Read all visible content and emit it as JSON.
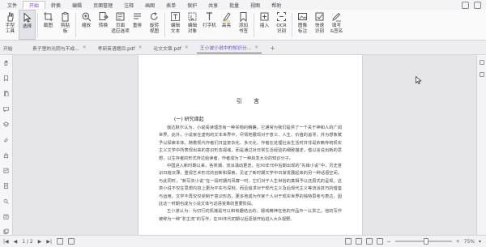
{
  "menu": {
    "tabs": [
      "文件",
      "开始",
      "转换",
      "编辑",
      "页面管理",
      "注释",
      "画图",
      "表单",
      "保护",
      "共享",
      "批量",
      "视图",
      "帮助"
    ],
    "active_tab": "开始"
  },
  "ribbon": {
    "tools": [
      {
        "label": "手型\n工具",
        "icon": "hand-icon"
      },
      {
        "label": "选择",
        "icon": "cursor-icon"
      },
      {
        "label": "截图",
        "icon": "snapshot-icon"
      },
      {
        "label": "剪贴\n板",
        "icon": "clipboard-icon"
      },
      {
        "label": "缩放",
        "icon": "zoom-icon"
      },
      {
        "label": "转换",
        "icon": "convert-icon"
      },
      {
        "label": "页面\n适应选项",
        "icon": "fit-page-icon"
      },
      {
        "label": "重排",
        "icon": "reflow-icon"
      },
      {
        "label": "旋转\n视图",
        "icon": "rotate-icon"
      },
      {
        "label": "编辑\n文本",
        "icon": "edit-text-icon"
      },
      {
        "label": "编辑\n对象",
        "icon": "edit-object-icon"
      },
      {
        "label": "打字机",
        "icon": "typewriter-icon"
      },
      {
        "label": "高亮",
        "icon": "highlight-icon"
      },
      {
        "label": "添加\n书签",
        "icon": "bookmark-icon"
      },
      {
        "label": "插入",
        "icon": "insert-icon"
      },
      {
        "label": "OCR\n识别",
        "icon": "ocr-icon"
      },
      {
        "label": "图像\n标注",
        "icon": "image-annot-icon"
      },
      {
        "label": "快速\n识别",
        "icon": "quick-ocr-icon"
      },
      {
        "label": "填写\n&签名",
        "icon": "sign-icon"
      }
    ]
  },
  "tabs": {
    "start_label": "开始",
    "docs": [
      {
        "title": "贵子里的光阴与不成...",
        "active": false
      },
      {
        "title": "考研英语题目.pdf",
        "active": false
      },
      {
        "title": "论文文章.pdf",
        "active": false
      },
      {
        "title": "王小波小说中的知识分...",
        "active": true
      }
    ],
    "add_label": "+"
  },
  "document": {
    "title": "引 言",
    "section": "(一) 研究缘起",
    "paragraphs": [
      "伽达默尔认为，小说阅读理念有一种实物的精确，它通常为我们提供了一个关于神和人的广阔世界。此外，小说家在虚构的文本世界中，尽情地展现对于意义、人生、价值的追寻，并为想象赋予以探索本体。随着现代作者们日益复杂化、多元化，作者在处理社会生活时并非是依赖传统现实主义文学中所表现出来的意识形态视域，而是通过对日常生活经验的细致描述，借以言说出新的思想，以生存者的形式传达给读者，作者成为了一种启发大众的知识分子。",
      "中国进入新时期以来，各类潮、流派涌动更迭。在90年代中后期出现的“先锋小说”中，历史意识日趋淡薄，重视艺术形式的创新和探索，见证了新时期文学中日渐发展起来的另一种话语空间。与此同时，“新写实小说”在一段时期内风靡一时，它们对于人生世俗的真相予以还原式的呈现。这类小说不仅在思想内容上更为平实与深刻，而且追求对于现代主义及后现代主义等流派技巧的借鉴与运用。文学不再仅仅受制于意识形态，更多地成为作家个人对于现实世界的独特思考与表达，因此这一时期也成为小说文体与话语变革的重要阶段。",
      "王小波认为：为切行的机械是可以和有趣结合的，嬉戏精神在他的作品中一以贯之。他的写作被称为一种“非主流”的写作，在90年代初期以后逐渐开始进入大众视野。"
    ]
  },
  "status": {
    "page_indicator": "1 / 2",
    "zoom": "75%"
  }
}
